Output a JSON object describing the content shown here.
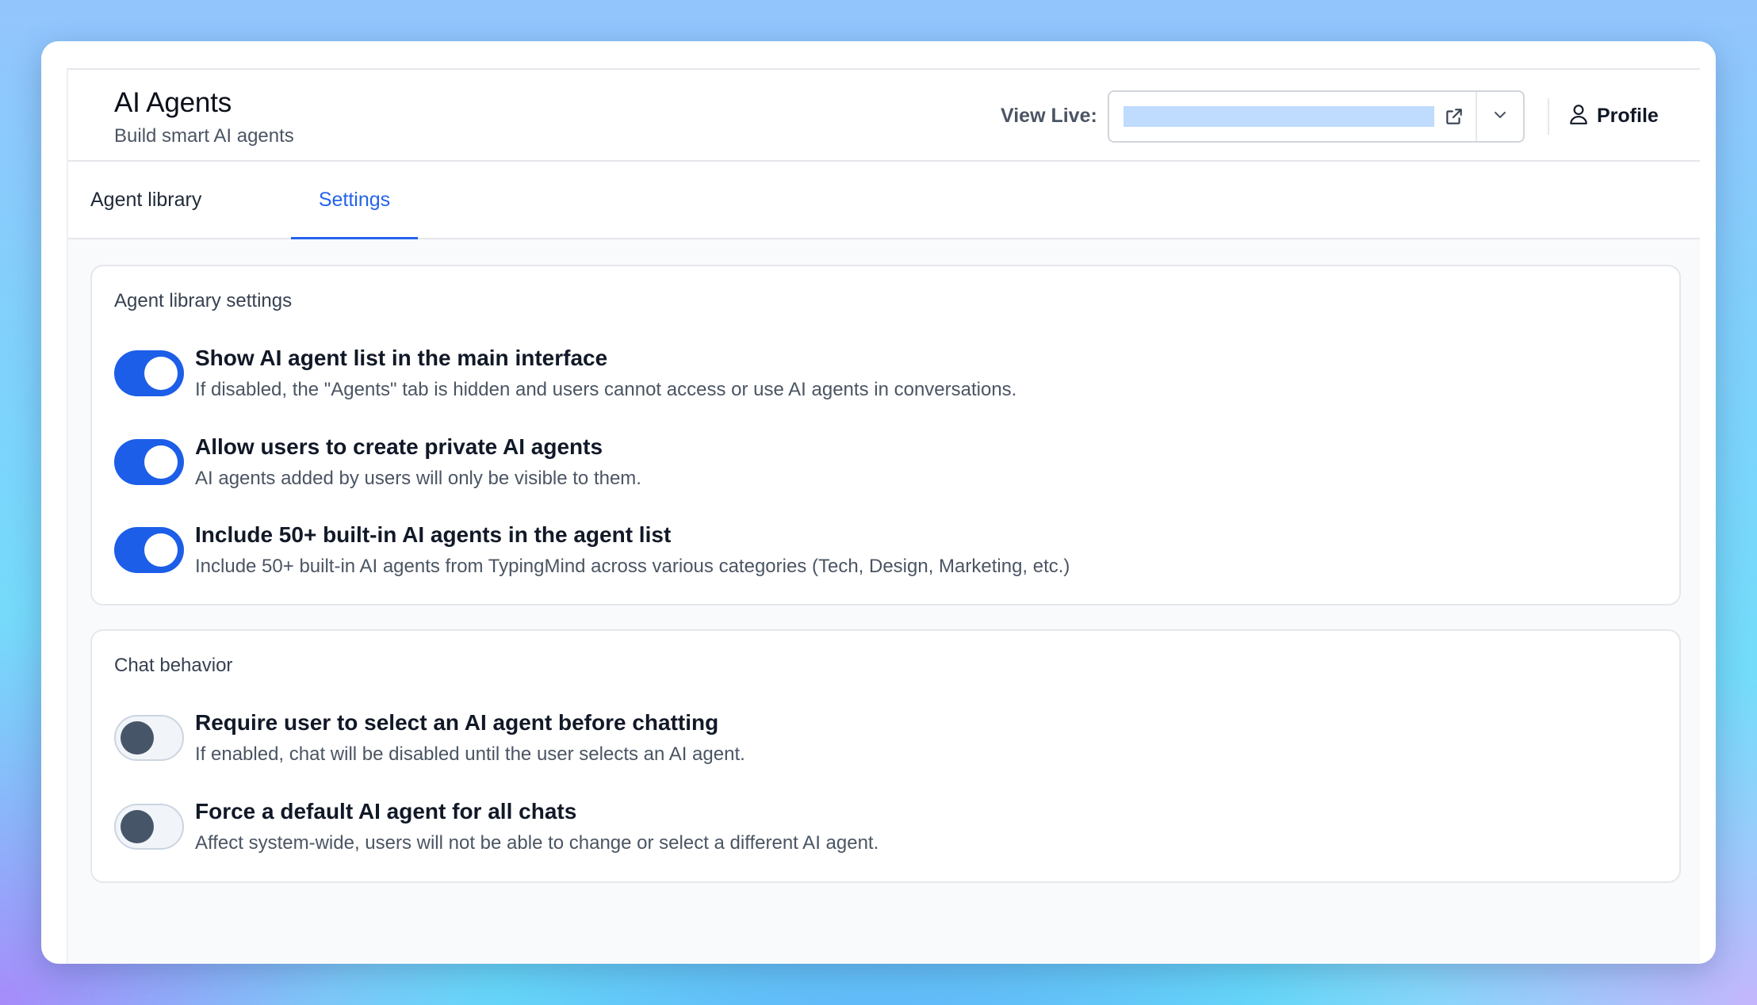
{
  "header": {
    "title": "AI Agents",
    "subtitle": "Build smart AI agents",
    "view_live_label": "View Live:",
    "view_live_url": "",
    "profile_label": "Profile"
  },
  "tabs": [
    {
      "label": "Agent library",
      "active": false
    },
    {
      "label": "Settings",
      "active": true
    }
  ],
  "sections": [
    {
      "title": "Agent library settings",
      "settings": [
        {
          "title": "Show AI agent list in the main interface",
          "description": "If disabled, the \"Agents\" tab is hidden and users cannot access or use AI agents in conversations.",
          "enabled": true
        },
        {
          "title": "Allow users to create private AI agents",
          "description": "AI agents added by users will only be visible to them.",
          "enabled": true
        },
        {
          "title": "Include 50+ built-in AI agents in the agent list",
          "description": "Include 50+ built-in AI agents from TypingMind across various categories (Tech, Design, Marketing, etc.)",
          "enabled": true
        }
      ]
    },
    {
      "title": "Chat behavior",
      "settings": [
        {
          "title": "Require user to select an AI agent before chatting",
          "description": "If enabled, chat will be disabled until the user selects an AI agent.",
          "enabled": false
        },
        {
          "title": "Force a default AI agent for all chats",
          "description": "Affect system-wide, users will not be able to change or select a different AI agent.",
          "enabled": false
        }
      ]
    }
  ],
  "colors": {
    "accent": "#2563eb",
    "toggle_on": "#1d5ee8",
    "toggle_off_knob": "#475569",
    "url_redaction": "#bfdbfe"
  },
  "icons": {
    "external_link": "external-link-icon",
    "dropdown": "chevron-down-icon",
    "profile": "user-icon"
  }
}
